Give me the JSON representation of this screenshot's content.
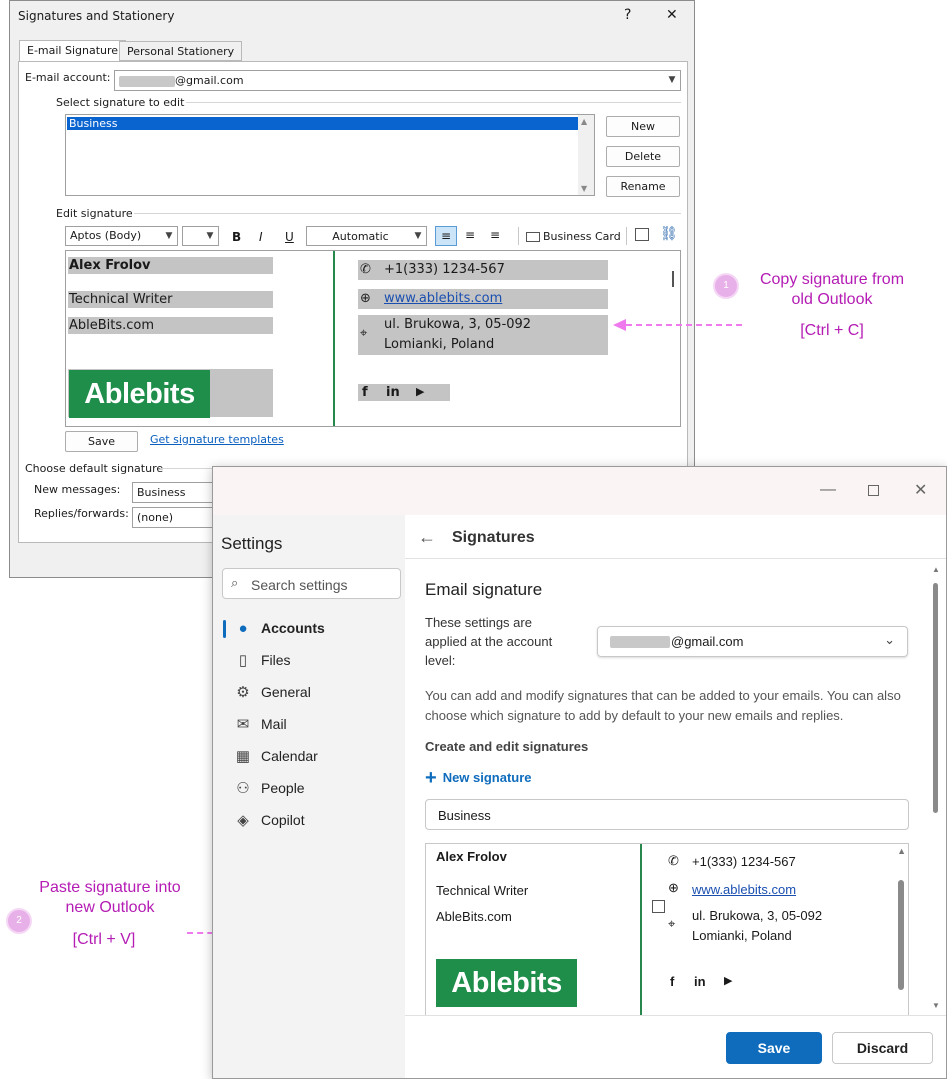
{
  "old_dialog": {
    "title": "Signatures and Stationery",
    "help": "?",
    "close": "✕",
    "tabs": [
      "E-mail Signature",
      "Personal Stationery"
    ],
    "email_account_label": "E-mail account:",
    "email_account_value": "@gmail.com",
    "select_sig_label": "Select signature to edit",
    "signatures": [
      "Business"
    ],
    "buttons": {
      "new": "New",
      "delete": "Delete",
      "rename": "Rename",
      "save": "Save"
    },
    "edit_sig_label": "Edit signature",
    "font": "Aptos (Body)",
    "color": "Automatic",
    "bold": "B",
    "italic": "I",
    "underline": "U",
    "business_card": "Business Card",
    "templates_link": "Get signature templates",
    "default_sig_label": "Choose default signature",
    "new_messages_label": "New messages:",
    "new_messages_value": "Business",
    "replies_label": "Replies/forwards:",
    "replies_value": "(none)"
  },
  "signature": {
    "name": "Alex Frolov",
    "title": "Technical Writer",
    "company": "AbleBits.com",
    "logo": "Ablebits",
    "phone": "+1(333) 1234-567",
    "website": "www.ablebits.com",
    "address_line1": "ul. Brukowa, 3, 05-092",
    "address_line2": "Lomianki, Poland",
    "social": [
      "f",
      "in",
      "▶"
    ]
  },
  "annotations": {
    "step1_num": "1",
    "step1_line1": "Copy signature from",
    "step1_line2": "old Outlook",
    "step1_keys": "[Ctrl + C]",
    "step2_num": "2",
    "step2_line1": "Paste signature into",
    "step2_line2": "new Outlook",
    "step2_keys": "[Ctrl + V]"
  },
  "new_outlook": {
    "settings_title": "Settings",
    "search_placeholder": "Search settings",
    "nav": [
      "Accounts",
      "Files",
      "General",
      "Mail",
      "Calendar",
      "People",
      "Copilot"
    ],
    "page_title": "Signatures",
    "section_title": "Email signature",
    "account_text": "These settings are applied at the account level:",
    "account_value": "@gmail.com",
    "description": "You can add and modify signatures that can be added to your emails. You can also choose which signature to add by default to your new emails and replies.",
    "create_label": "Create and edit signatures",
    "new_signature": "New signature",
    "sig_name_value": "Business",
    "save": "Save",
    "discard": "Discard"
  },
  "colors": {
    "accent": "#0f6cbd",
    "annotation": "#b41cb4",
    "logo": "#1e8e4a"
  }
}
